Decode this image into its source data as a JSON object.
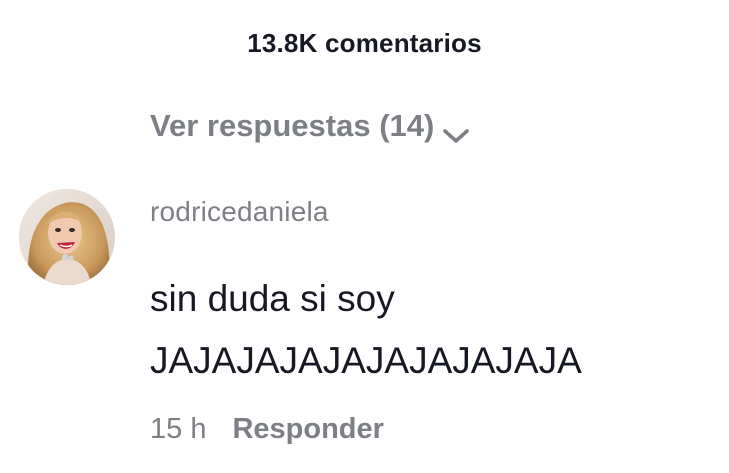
{
  "header": {
    "comment_count": "13.8K comentarios"
  },
  "replies": {
    "view_label": "Ver respuestas (14)",
    "chevron_icon": "chevron-down-icon"
  },
  "comment": {
    "avatar_icon": "user-avatar",
    "username": "rodricedaniela",
    "text": "sin duda si soy\nJAJAJAJAJAJAJAJAJAJA",
    "time": "15 h",
    "reply_label": "Responder"
  },
  "colors": {
    "primary_text": "#161823",
    "secondary_text": "#7d7f87",
    "background": "#ffffff"
  }
}
